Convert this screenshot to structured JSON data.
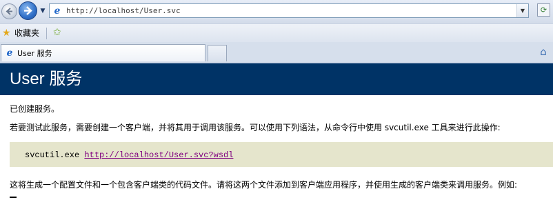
{
  "browser": {
    "address": "http://localhost/User.svc",
    "favorites_label": "收藏夹",
    "tab_title": "User 服务"
  },
  "page": {
    "heading": "User 服务",
    "line1": "已创建服务。",
    "line2": "若要测试此服务，需要创建一个客户端，并将其用于调用该服务。可以使用下列语法，从命令行中使用 svcutil.exe 工具来进行此操作:",
    "code_command": "svcutil.exe",
    "code_link": "http://localhost/User.svc?wsdl",
    "line3": "这将生成一个配置文件和一个包含客户端类的代码文件。请将这两个文件添加到客户端应用程序，并使用生成的客户端类来调用服务。例如:"
  },
  "colors": {
    "heading_band": "#003366",
    "code_background": "#e5e5cc",
    "visited_link": "#800080"
  },
  "icons": {
    "back": "back-arrow-icon",
    "forward": "forward-arrow-icon",
    "page": "ie-page-icon",
    "favorites": "star-icon",
    "add_favorite": "add-favorite-icon",
    "home": "home-icon",
    "refresh": "refresh-icon"
  }
}
